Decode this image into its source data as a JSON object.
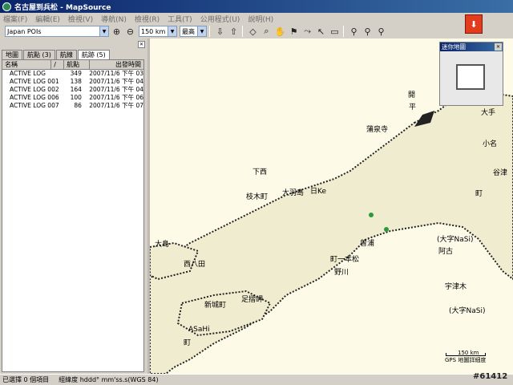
{
  "window": {
    "title": "名古屋到兵松 - MapSource"
  },
  "menu": [
    "檔案(F)",
    "編輯(E)",
    "檢視(V)",
    "導航(N)",
    "檢視(R)",
    "工具(T)",
    "公用程式(U)",
    "說明(H)"
  ],
  "toolbar": {
    "map_product": "Japan POIs",
    "zoom_scale": "150 km",
    "detail_level": "最高"
  },
  "panel": {
    "tabs": [
      "地圖",
      "航點 (3)",
      "航線",
      "航跡 (5)"
    ],
    "active_tab": 3,
    "columns": [
      "名稱",
      "/",
      "航點",
      "出發時間"
    ],
    "rows": [
      {
        "name": "ACTIVE LOG",
        "points": "349",
        "start": "2007/11/6 下午 03"
      },
      {
        "name": "ACTIVE LOG 001",
        "points": "138",
        "start": "2007/11/6 下午 04"
      },
      {
        "name": "ACTIVE LOG 002",
        "points": "164",
        "start": "2007/11/6 下午 04"
      },
      {
        "name": "ACTIVE LOG 006",
        "points": "100",
        "start": "2007/11/6 下午 06"
      },
      {
        "name": "ACTIVE LOG 007",
        "points": "86",
        "start": "2007/11/6 下午 07"
      }
    ]
  },
  "overview": {
    "title": "迷你地圖"
  },
  "map": {
    "labels": [
      "開",
      "平",
      "大手",
      "蒲泉寺",
      "小名",
      "谷津",
      "町",
      "下西",
      "日Ke",
      "大羽島",
      "枝木町",
      "(大字NaSi)",
      "阿古",
      "大島",
      "西八田",
      "曾浦",
      "町一本松",
      "野川",
      "宇津木",
      "(大字NaSi)",
      "足摺岬",
      "新城町",
      "ASaHi",
      "町"
    ],
    "scale_label": "150 km",
    "footer_note": "GPS 地圖詳細度"
  },
  "status": {
    "selection": "已選擇 0 個項目",
    "coords": "經緯度 hddd° mm'ss.s(WGS 84)"
  },
  "watermark": "#61412"
}
